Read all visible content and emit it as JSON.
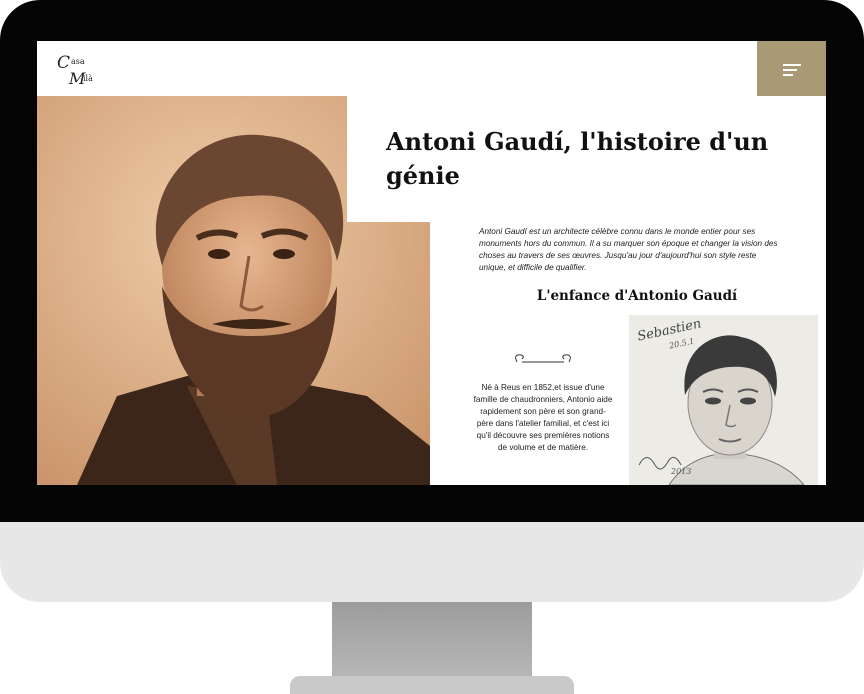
{
  "logo": {
    "line1_initial": "C",
    "line1_rest": "asa",
    "line2_initial": "M",
    "line2_rest": "ilà"
  },
  "menu": {
    "icon": "hamburger-icon",
    "color": "#a79a74"
  },
  "hero": {
    "title": "Antoni Gaudí, l'histoire d'un génie",
    "intro": "Antoni Gaudí est un architecte célèbre connu dans le monde entier pour ses monuments hors du commun. Il a su marquer son époque et changer la vision des choses au travers de ses œuvres. Jusqu'au jour d'aujourd'hui son style reste unique, et difficile de qualifier."
  },
  "childhood": {
    "title": "L'enfance d'Antonio Gaudí",
    "text": "Né à Reus en 1852,et issue d'une famille de chaudronniers, Antonio aide rapidement son père et son grand-père dans l'atelier familial, et c'est ici qu'il découvre ses premières notions de volume et de matière."
  },
  "sketch": {
    "label": "Sebastien",
    "sub_label": "20.5.1",
    "signature_year": "2013"
  },
  "colors": {
    "accent": "#a79a74",
    "photo_tone": "#d9b08a",
    "monitor": "#050505",
    "monitor_chin": "#e7e7e7"
  }
}
